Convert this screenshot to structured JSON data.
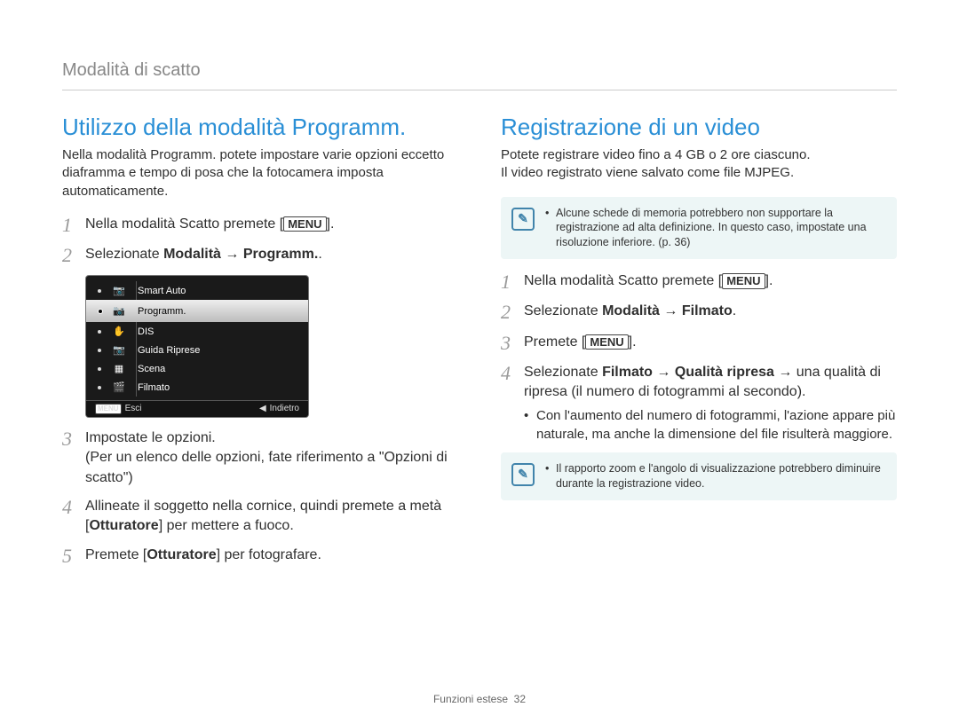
{
  "header": "Modalità di scatto",
  "left": {
    "title": "Utilizzo della modalità Programm.",
    "intro": "Nella modalità Programm. potete impostare varie opzioni eccetto diaframma e tempo di posa che la fotocamera imposta automaticamente.",
    "step1_a": "Nella modalità Scatto premete [",
    "step1_key": "MENU",
    "step1_b": "].",
    "step2_a": "Selezionate ",
    "step2_b": "Modalità",
    "step2_c": " → ",
    "step2_d": "Programm.",
    "step2_e": ".",
    "menu": {
      "items": [
        {
          "label": "Smart Auto"
        },
        {
          "label": "Programm."
        },
        {
          "label": "DIS"
        },
        {
          "label": "Guida Riprese"
        },
        {
          "label": "Scena"
        },
        {
          "label": "Filmato"
        }
      ],
      "footer_left_key": "MENU",
      "footer_left": "Esci",
      "footer_right_glyph": "◀",
      "footer_right": "Indietro"
    },
    "step3": "Impostate le opzioni.\n(Per un elenco delle opzioni, fate riferimento a \"Opzioni di scatto\")",
    "step4_a": "Allineate il soggetto nella cornice, quindi premete a metà [",
    "step4_key": "Otturatore",
    "step4_b": "] per mettere a fuoco.",
    "step5_a": "Premete [",
    "step5_key": "Otturatore",
    "step5_b": "] per fotografare."
  },
  "right": {
    "title": "Registrazione di un video",
    "intro": "Potete registrare video fino a 4 GB o 2 ore ciascuno.\nIl video registrato viene salvato come file MJPEG.",
    "tip1": "Alcune schede di memoria potrebbero non supportare la registrazione ad alta definizione. In questo caso, impostate una risoluzione inferiore. (p. 36)",
    "step1_a": "Nella modalità Scatto premete [",
    "step1_key": "MENU",
    "step1_b": "].",
    "step2_a": "Selezionate ",
    "step2_b": "Modalità",
    "step2_c": " → ",
    "step2_d": "Filmato",
    "step2_e": ".",
    "step3_a": "Premete [",
    "step3_key": "MENU",
    "step3_b": "].",
    "step4_a": "Selezionate ",
    "step4_b": "Filmato",
    "step4_c": " → ",
    "step4_d": "Qualità ripresa",
    "step4_e": " → una qualità di ripresa (il numero di fotogrammi al secondo).",
    "step4_sub": "Con l'aumento del numero di fotogrammi, l'azione appare più naturale, ma anche la dimensione del file risulterà maggiore.",
    "tip2": "Il rapporto zoom e l'angolo di visualizzazione potrebbero diminuire durante la registrazione video."
  },
  "footer_label": "Funzioni estese",
  "footer_page": "32"
}
